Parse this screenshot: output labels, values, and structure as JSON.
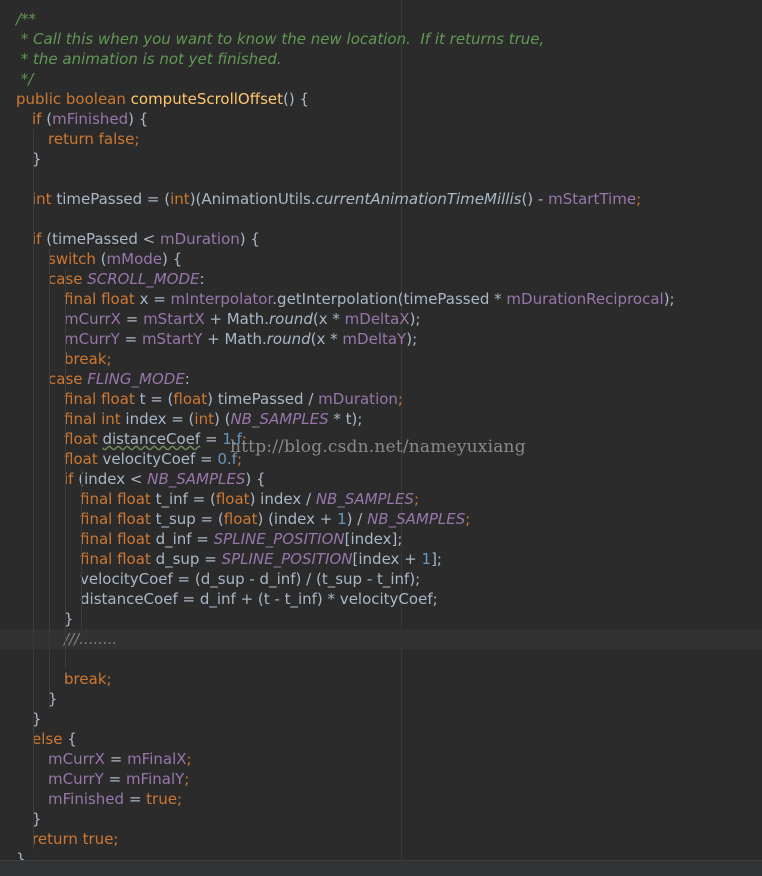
{
  "theme": {
    "background": "#2b2b2b",
    "keyword": "#cc7832",
    "field": "#9876aa",
    "method": "#ffc66d",
    "doc_comment": "#629755",
    "default_text": "#a9b7c6"
  },
  "watermark": "http://blog.csdn.net/nameyuxiang",
  "code_lines": [
    [
      {
        "t": "/**",
        "c": "doc"
      }
    ],
    [
      {
        "t": " * Call this when you want to know the new location.  If it returns true,",
        "c": "doc"
      }
    ],
    [
      {
        "t": " * the animation is not yet finished.",
        "c": "doc"
      }
    ],
    [
      {
        "t": " */",
        "c": "doc"
      }
    ],
    [
      {
        "t": "public boolean ",
        "c": "kw"
      },
      {
        "t": "computeScrollOffset",
        "c": "method"
      },
      {
        "t": "() {",
        "c": "plain"
      }
    ],
    [
      {
        "t": "if ",
        "c": "kw"
      },
      {
        "t": "(",
        "c": "plain"
      },
      {
        "t": "mFinished",
        "c": "field"
      },
      {
        "t": ") {",
        "c": "plain"
      }
    ],
    [
      {
        "t": "return false;",
        "c": "kw"
      }
    ],
    [
      {
        "t": "}",
        "c": "plain"
      }
    ],
    [],
    [
      {
        "t": "int ",
        "c": "kw"
      },
      {
        "t": "timePassed = (",
        "c": "plain"
      },
      {
        "t": "int",
        "c": "kw"
      },
      {
        "t": ")(AnimationUtils.",
        "c": "plain"
      },
      {
        "t": "currentAnimationTimeMillis",
        "c": "italic"
      },
      {
        "t": "() - ",
        "c": "plain"
      },
      {
        "t": "mStartTime",
        "c": "field"
      },
      {
        "t": ";",
        "c": "kw"
      }
    ],
    [],
    [
      {
        "t": "if ",
        "c": "kw"
      },
      {
        "t": "(timePassed < ",
        "c": "plain"
      },
      {
        "t": "mDuration",
        "c": "field"
      },
      {
        "t": ") {",
        "c": "plain"
      }
    ],
    [
      {
        "t": "switch ",
        "c": "kw"
      },
      {
        "t": "(",
        "c": "plain"
      },
      {
        "t": "mMode",
        "c": "field"
      },
      {
        "t": ") {",
        "c": "plain"
      }
    ],
    [
      {
        "t": "case ",
        "c": "kw"
      },
      {
        "t": "SCROLL_MODE",
        "c": "static"
      },
      {
        "t": ":",
        "c": "plain"
      }
    ],
    [
      {
        "t": "final float ",
        "c": "kw"
      },
      {
        "t": "x = ",
        "c": "plain"
      },
      {
        "t": "mInterpolator",
        "c": "field"
      },
      {
        "t": ".getInterpolation(timePassed * ",
        "c": "plain"
      },
      {
        "t": "mDurationReciprocal",
        "c": "field"
      },
      {
        "t": ");",
        "c": "plain"
      }
    ],
    [
      {
        "t": "mCurrX",
        "c": "field"
      },
      {
        "t": " = ",
        "c": "plain"
      },
      {
        "t": "mStartX",
        "c": "field"
      },
      {
        "t": " + Math.",
        "c": "plain"
      },
      {
        "t": "round",
        "c": "italic"
      },
      {
        "t": "(x * ",
        "c": "plain"
      },
      {
        "t": "mDeltaX",
        "c": "field"
      },
      {
        "t": ");",
        "c": "plain"
      }
    ],
    [
      {
        "t": "mCurrY",
        "c": "field"
      },
      {
        "t": " = ",
        "c": "plain"
      },
      {
        "t": "mStartY",
        "c": "field"
      },
      {
        "t": " + Math.",
        "c": "plain"
      },
      {
        "t": "round",
        "c": "italic"
      },
      {
        "t": "(x * ",
        "c": "plain"
      },
      {
        "t": "mDeltaY",
        "c": "field"
      },
      {
        "t": ");",
        "c": "plain"
      }
    ],
    [
      {
        "t": "break;",
        "c": "kw"
      }
    ],
    [
      {
        "t": "case ",
        "c": "kw"
      },
      {
        "t": "FLING_MODE",
        "c": "static"
      },
      {
        "t": ":",
        "c": "plain"
      }
    ],
    [
      {
        "t": "final float ",
        "c": "kw"
      },
      {
        "t": "t = (",
        "c": "plain"
      },
      {
        "t": "float",
        "c": "kw"
      },
      {
        "t": ") timePassed / ",
        "c": "plain"
      },
      {
        "t": "mDuration",
        "c": "field"
      },
      {
        "t": ";",
        "c": "kw"
      }
    ],
    [
      {
        "t": "final int ",
        "c": "kw"
      },
      {
        "t": "index = (",
        "c": "plain"
      },
      {
        "t": "int",
        "c": "kw"
      },
      {
        "t": ") (",
        "c": "plain"
      },
      {
        "t": "NB_SAMPLES",
        "c": "static"
      },
      {
        "t": " * t);",
        "c": "plain"
      }
    ],
    [
      {
        "t": "float ",
        "c": "kw"
      },
      {
        "t": "distanceCoef",
        "c": "warn"
      },
      {
        "t": " = ",
        "c": "plain"
      },
      {
        "t": "1.f",
        "c": "num"
      },
      {
        "t": ";",
        "c": "kw"
      }
    ],
    [
      {
        "t": "float ",
        "c": "kw"
      },
      {
        "t": "velocityCoef = ",
        "c": "plain"
      },
      {
        "t": "0.f",
        "c": "num"
      },
      {
        "t": ";",
        "c": "kw"
      }
    ],
    [
      {
        "t": "if ",
        "c": "kw"
      },
      {
        "t": "(index < ",
        "c": "plain"
      },
      {
        "t": "NB_SAMPLES",
        "c": "static"
      },
      {
        "t": ") {",
        "c": "plain"
      }
    ],
    [
      {
        "t": "final float ",
        "c": "kw"
      },
      {
        "t": "t_inf = (",
        "c": "plain"
      },
      {
        "t": "float",
        "c": "kw"
      },
      {
        "t": ") index / ",
        "c": "plain"
      },
      {
        "t": "NB_SAMPLES",
        "c": "static"
      },
      {
        "t": ";",
        "c": "kw"
      }
    ],
    [
      {
        "t": "final float ",
        "c": "kw"
      },
      {
        "t": "t_sup = (",
        "c": "plain"
      },
      {
        "t": "float",
        "c": "kw"
      },
      {
        "t": ") (index + ",
        "c": "plain"
      },
      {
        "t": "1",
        "c": "num"
      },
      {
        "t": ") / ",
        "c": "plain"
      },
      {
        "t": "NB_SAMPLES",
        "c": "static"
      },
      {
        "t": ";",
        "c": "kw"
      }
    ],
    [
      {
        "t": "final float ",
        "c": "kw"
      },
      {
        "t": "d_inf = ",
        "c": "plain"
      },
      {
        "t": "SPLINE_POSITION",
        "c": "static"
      },
      {
        "t": "[index];",
        "c": "plain"
      }
    ],
    [
      {
        "t": "final float ",
        "c": "kw"
      },
      {
        "t": "d_sup = ",
        "c": "plain"
      },
      {
        "t": "SPLINE_POSITION",
        "c": "static"
      },
      {
        "t": "[index + ",
        "c": "plain"
      },
      {
        "t": "1",
        "c": "num"
      },
      {
        "t": "];",
        "c": "plain"
      }
    ],
    [
      {
        "t": "velocityCoef = (d_sup - d_inf) / (t_sup - t_inf);",
        "c": "plain"
      }
    ],
    [
      {
        "t": "distanceCoef = d_inf + (t - t_inf) * velocityCoef;",
        "c": "plain"
      }
    ],
    [
      {
        "t": "}",
        "c": "plain"
      }
    ],
    [
      {
        "t": "///........",
        "c": "comment"
      }
    ],
    [],
    [
      {
        "t": "break;",
        "c": "kw"
      }
    ],
    [
      {
        "t": "}",
        "c": "plain"
      }
    ],
    [
      {
        "t": "}",
        "c": "plain"
      }
    ],
    [
      {
        "t": "else ",
        "c": "kw"
      },
      {
        "t": "{",
        "c": "plain"
      }
    ],
    [
      {
        "t": "mCurrX",
        "c": "field"
      },
      {
        "t": " = ",
        "c": "plain"
      },
      {
        "t": "mFinalX",
        "c": "field"
      },
      {
        "t": ";",
        "c": "kw"
      }
    ],
    [
      {
        "t": "mCurrY",
        "c": "field"
      },
      {
        "t": " = ",
        "c": "plain"
      },
      {
        "t": "mFinalY",
        "c": "field"
      },
      {
        "t": ";",
        "c": "kw"
      }
    ],
    [
      {
        "t": "mFinished",
        "c": "field"
      },
      {
        "t": " = ",
        "c": "plain"
      },
      {
        "t": "true;",
        "c": "kw"
      }
    ],
    [
      {
        "t": "}",
        "c": "plain"
      }
    ],
    [
      {
        "t": "return true;",
        "c": "kw"
      }
    ],
    [
      {
        "t": "}",
        "c": "plain"
      }
    ]
  ]
}
